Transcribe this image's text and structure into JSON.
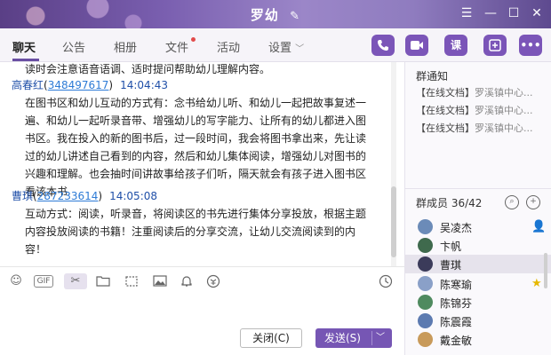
{
  "window": {
    "title": "罗幼",
    "edit_icon": "pencil-icon",
    "controls": [
      "menu",
      "minimize",
      "maximize",
      "close"
    ]
  },
  "tabs": [
    {
      "label": "聊天",
      "active": true
    },
    {
      "label": "公告"
    },
    {
      "label": "相册"
    },
    {
      "label": "文件",
      "has_dot": true
    },
    {
      "label": "活动"
    },
    {
      "label": "设置"
    }
  ],
  "header_actions": {
    "phone": "phone-icon",
    "video": "video-icon",
    "lesson_label": "课",
    "add": "plus-icon",
    "more": "more-icon",
    "accent": "#7b55b8"
  },
  "messages": [
    {
      "text_lines": [
        "读时会注意语音语调、适时提问帮助幼儿理解内容。"
      ]
    },
    {
      "sender": "高春红",
      "qq": "348497617",
      "time": "14:04:43",
      "text_lines": [
        "在图书区和幼儿互动的方式有：念书给幼儿听、和幼儿一起把故事复述一",
        "遍、和幼儿一起听录音带、增强幼儿的写字能力、让所有的幼儿都进入图",
        "书区。我在投入的新的图书后，过一段时间，我会将图书拿出来，先让读",
        "过的幼儿讲述自己看到的内容，然后和幼儿集体阅读，增强幼儿对图书的",
        "兴趣和理解。也会抽时间讲故事给孩子们听，隔天就会有孩子进入图书区",
        "看该本书"
      ]
    },
    {
      "sender": "曹琪",
      "qq": "287233614",
      "time": "14:05:08",
      "text_lines": [
        "互动方式：阅读，听录音，将阅读区的书先进行集体分享投放，根据主题",
        "内容投放阅读的书籍！注重阅读后的分享交流，让幼儿交流阅读到的内",
        "容！"
      ]
    }
  ],
  "input_toolbar": [
    "emoji-icon",
    "gif-icon",
    "scissors-icon",
    "folder-icon",
    "screenshot-icon",
    "image-icon",
    "bell-icon",
    "red-packet-icon",
    "history-icon"
  ],
  "input_toolbar_gif_label": "GIF",
  "buttons": {
    "close_label": "关闭(C)",
    "send_label": "发送(S)"
  },
  "group_notice": {
    "title": "群通知",
    "items": [
      {
        "prefix": "【在线文档】",
        "text": "罗溪镇中心..."
      },
      {
        "prefix": "【在线文档】",
        "text": "罗溪镇中心..."
      },
      {
        "prefix": "【在线文档】",
        "text": "罗溪镇中心..."
      }
    ]
  },
  "members": {
    "title": "群成员 36/42",
    "list": [
      {
        "name": "吴凌杰",
        "badge": "person-icon",
        "avatar_color": "#6b8bb8"
      },
      {
        "name": "卞帆",
        "avatar_color": "#3f6a4d"
      },
      {
        "name": "曹琪",
        "selected": true,
        "avatar_color": "#3b3b5a"
      },
      {
        "name": "陈寒瑜",
        "badge": "star-icon",
        "avatar_color": "#8aa0c8"
      },
      {
        "name": "陈锦芬",
        "avatar_color": "#4f8a5f"
      },
      {
        "name": "陈震霞",
        "avatar_color": "#5c7ab0"
      },
      {
        "name": "戴金敏",
        "avatar_color": "#c89a5a"
      }
    ]
  }
}
